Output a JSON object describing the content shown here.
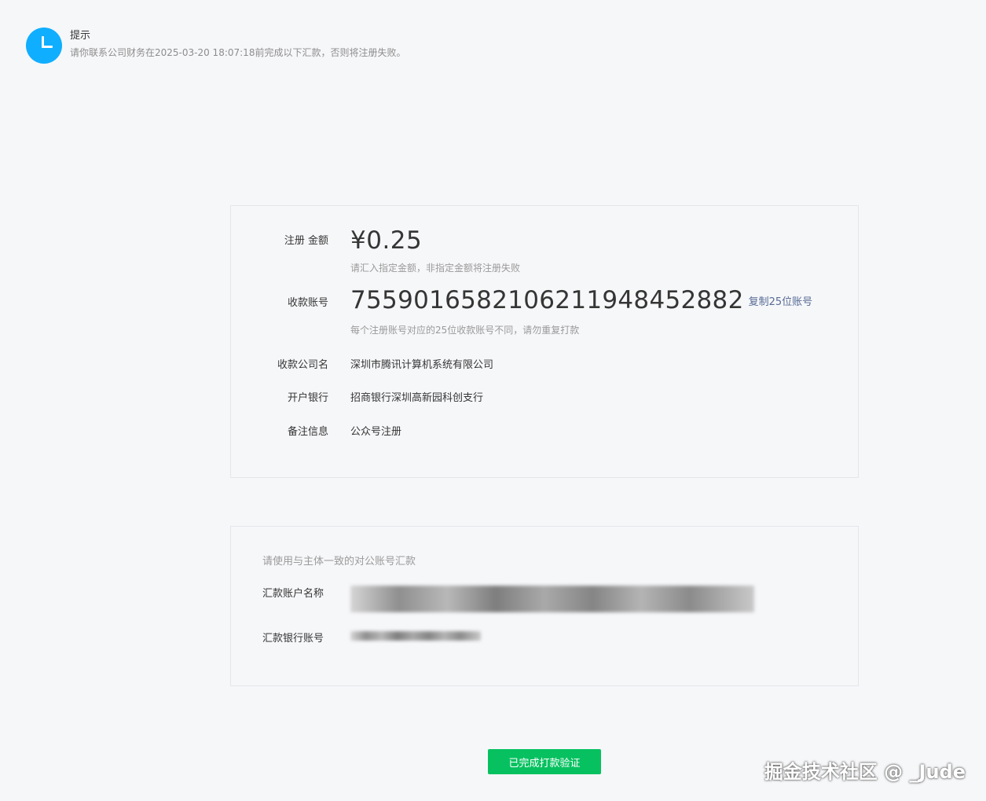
{
  "notice": {
    "icon": "clock-icon",
    "title": "提示",
    "desc": "请你联系公司财务在2025-03-20 18:07:18前完成以下汇款，否则将注册失败。"
  },
  "payment": {
    "amount_label": "注册 金额",
    "amount": "¥0.25",
    "amount_hint": "请汇入指定金额，非指定金额将注册失败",
    "account_label": "收款账号",
    "account_prefix": "755901658210621",
    "account_highlight": "1948452882",
    "copy_label": "复制25位账号",
    "account_hint": "每个注册账号对应的25位收款账号不同，请勿重复打款",
    "company_label": "收款公司名",
    "company": "深圳市腾讯计算机系统有限公司",
    "bank_label": "开户银行",
    "bank": "招商银行深圳高新园科创支行",
    "remark_label": "备注信息",
    "remark": "公众号注册"
  },
  "sender": {
    "tip": "请使用与主体一致的对公账号汇款",
    "name_label": "汇款账户名称",
    "account_label": "汇款银行账号"
  },
  "done_button": "已完成打款验证",
  "watermark": "掘金技术社区 @ _Jude",
  "colors": {
    "accent_green": "#07c160",
    "info_blue": "#10aeff",
    "link_blue": "#576b95"
  }
}
